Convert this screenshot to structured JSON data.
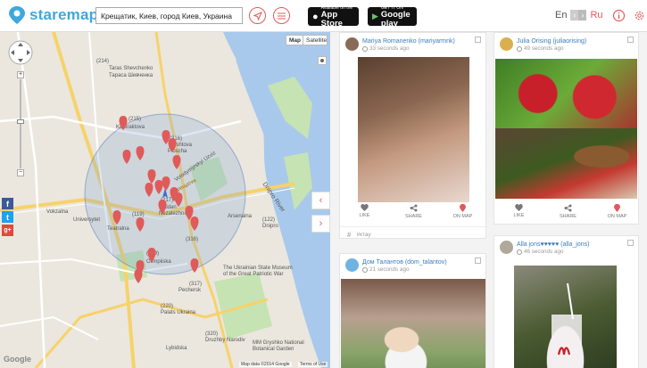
{
  "app": {
    "name": "staremap"
  },
  "search": {
    "value": "Крещатик, Киев, город Киев, Украина"
  },
  "stores": {
    "apple_small": "Available on the",
    "apple_big": "App Store",
    "google_small": "GET IT ON",
    "google_big": "Google play"
  },
  "lang": {
    "en": "En",
    "ru": "Ru"
  },
  "map": {
    "type_map": "Map",
    "type_sat": "Satellite",
    "attribution": "Map data ©2014 Google",
    "terms": "Terms of Use",
    "google": "Google",
    "labels": [
      "(214)",
      "Taras Shevchenko",
      "Тараса Шевченка",
      "(215)",
      "Kontraktova",
      "Ploscha",
      "(316)",
      "Poshtova",
      "Ploscha",
      "Dnipro River",
      "Volodymyrskyi Uzviz",
      "(217)",
      "Maidan",
      "Nezalezhnosti",
      "(119)",
      "Teatralna",
      "Тeатральна",
      "Vokzalna",
      "Вокзальна",
      "University",
      "Universytet",
      "Arsenalna",
      "(122)",
      "Dnipro",
      "(316)",
      "Klovska",
      "(219)",
      "Olimpiiska",
      "The Ukrainian State Museum of the Great Patriotic War",
      "(317)",
      "Pechersk",
      "(220)",
      "Palats Ukraina",
      "MM Gryshko National Botanical Garden",
      "(320)",
      "Druzhby Narodiv",
      "Lisova",
      "(217)",
      "Lybidska",
      "Хрещатик"
    ],
    "accent": "#e05a5a",
    "route_color": "#f7d26b",
    "water": "#a8c9ec",
    "park": "#c6e3b3"
  },
  "feed": {
    "like": "LIKE",
    "share": "SHARE",
    "on_map": "ON MAP",
    "posts": [
      {
        "user": "Mariya Romanenko (mariyarmnk)",
        "time": "33 seconds ago",
        "tag": "#ктаy"
      },
      {
        "user": "Julia Orising (juliaorising)",
        "time": "49 seconds ago"
      },
      {
        "user": "Дом Талантов (dom_talantov)",
        "time": "21 seconds ago"
      },
      {
        "user": "Alla jons♥♥♥♥♥ (alla_jons)",
        "time": "46 seconds ago"
      }
    ]
  }
}
